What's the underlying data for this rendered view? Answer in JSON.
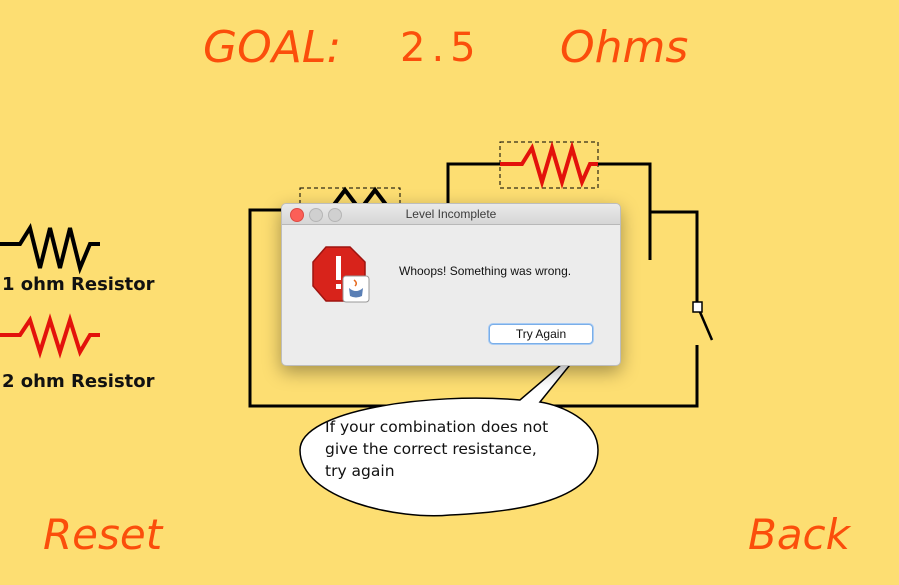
{
  "goal": {
    "prefix": "GOAL:",
    "value": "2.5",
    "unit": "Ohms"
  },
  "palette": [
    {
      "label": "1 ohm Resistor",
      "color": "#000000"
    },
    {
      "label": "2 ohm Resistor",
      "color": "#e3120b"
    }
  ],
  "buttons": {
    "reset": "Reset",
    "back": "Back"
  },
  "dialog": {
    "title": "Level Incomplete",
    "message": "Whoops! Something was wrong.",
    "button": "Try Again"
  },
  "hint": {
    "line1": "If your combination does  not",
    "line2": "give the correct resistance,",
    "line3": "try again"
  },
  "colors": {
    "background": "#fdde72",
    "accent": "#fb4e0b",
    "resistor_2ohm": "#e3120b"
  },
  "icons": [
    "stop-alert-icon",
    "java-coffee-icon",
    "switch-icon"
  ]
}
